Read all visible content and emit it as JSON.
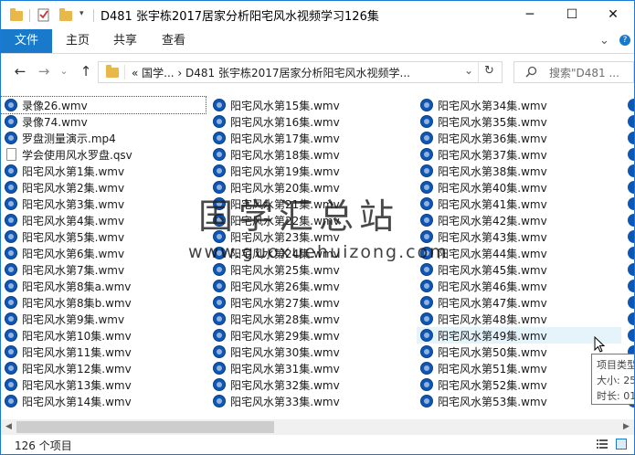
{
  "window": {
    "title": "D481 张宇栋2017居家分析阳宅风水视频学习126集",
    "minimize": "─",
    "maximize": "☐",
    "close": "✕"
  },
  "ribbon": {
    "file": "文件",
    "tabs": [
      "主页",
      "共享",
      "查看"
    ],
    "expand": "⌄",
    "help": "?"
  },
  "address": {
    "path": "« 国学...  ›  D481 张宇栋2017居家分析阳宅风水视频学...",
    "dropdown": "⌄",
    "refresh": "↻"
  },
  "search": {
    "placeholder": "搜索\"D481 ..."
  },
  "nav": {
    "back": "←",
    "forward": "→",
    "recent": "⌄",
    "up": "↑"
  },
  "files": {
    "col1": [
      {
        "name": "录像26.wmv",
        "icon": "media"
      },
      {
        "name": "录像74.wmv",
        "icon": "media"
      },
      {
        "name": "罗盘测量演示.mp4",
        "icon": "media"
      },
      {
        "name": "学会使用风水罗盘.qsv",
        "icon": "doc"
      },
      {
        "name": "阳宅风水第1集.wmv",
        "icon": "media"
      },
      {
        "name": "阳宅风水第2集.wmv",
        "icon": "media"
      },
      {
        "name": "阳宅风水第3集.wmv",
        "icon": "media"
      },
      {
        "name": "阳宅风水第4集.wmv",
        "icon": "media"
      },
      {
        "name": "阳宅风水第5集.wmv",
        "icon": "media"
      },
      {
        "name": "阳宅风水第6集.wmv",
        "icon": "media"
      },
      {
        "name": "阳宅风水第7集.wmv",
        "icon": "media"
      },
      {
        "name": "阳宅风水第8集a.wmv",
        "icon": "media"
      },
      {
        "name": "阳宅风水第8集b.wmv",
        "icon": "media"
      },
      {
        "name": "阳宅风水第9集.wmv",
        "icon": "media"
      },
      {
        "name": "阳宅风水第10集.wmv",
        "icon": "media"
      },
      {
        "name": "阳宅风水第11集.wmv",
        "icon": "media"
      },
      {
        "name": "阳宅风水第12集.wmv",
        "icon": "media"
      },
      {
        "name": "阳宅风水第13集.wmv",
        "icon": "media"
      },
      {
        "name": "阳宅风水第14集.wmv",
        "icon": "media"
      }
    ],
    "col2": [
      {
        "name": "阳宅风水第15集.wmv"
      },
      {
        "name": "阳宅风水第16集.wmv"
      },
      {
        "name": "阳宅风水第17集.wmv"
      },
      {
        "name": "阳宅风水第18集.wmv"
      },
      {
        "name": "阳宅风水第19集.wmv"
      },
      {
        "name": "阳宅风水第20集.wmv"
      },
      {
        "name": "阳宅风水第21集.wmv"
      },
      {
        "name": "阳宅风水第22集.wmv"
      },
      {
        "name": "阳宅风水第23集.wmv"
      },
      {
        "name": "阳宅风水第24集.wmv"
      },
      {
        "name": "阳宅风水第25集.wmv"
      },
      {
        "name": "阳宅风水第26集.wmv"
      },
      {
        "name": "阳宅风水第27集.wmv"
      },
      {
        "name": "阳宅风水第28集.wmv"
      },
      {
        "name": "阳宅风水第29集.wmv"
      },
      {
        "name": "阳宅风水第30集.wmv"
      },
      {
        "name": "阳宅风水第31集.wmv"
      },
      {
        "name": "阳宅风水第32集.wmv"
      },
      {
        "name": "阳宅风水第33集.wmv"
      }
    ],
    "col3": [
      {
        "name": "阳宅风水第34集.wmv"
      },
      {
        "name": "阳宅风水第35集.wmv"
      },
      {
        "name": "阳宅风水第36集.wmv"
      },
      {
        "name": "阳宅风水第37集.wmv"
      },
      {
        "name": "阳宅风水第38集.wmv"
      },
      {
        "name": "阳宅风水第40集.wmv"
      },
      {
        "name": "阳宅风水第41集.wmv"
      },
      {
        "name": "阳宅风水第42集.wmv"
      },
      {
        "name": "阳宅风水第43集.wmv"
      },
      {
        "name": "阳宅风水第44集.wmv"
      },
      {
        "name": "阳宅风水第45集.wmv"
      },
      {
        "name": "阳宅风水第46集.wmv"
      },
      {
        "name": "阳宅风水第47集.wmv"
      },
      {
        "name": "阳宅风水第48集.wmv"
      },
      {
        "name": "阳宅风水第49集.wmv"
      },
      {
        "name": "阳宅风水第50集.wmv"
      },
      {
        "name": "阳宅风水第51集.wmv"
      },
      {
        "name": "阳宅风水第52集.wmv"
      },
      {
        "name": "阳宅风水第53集.wmv"
      }
    ]
  },
  "tooltip": {
    "line1": "项目类型",
    "line2": "大小: 25",
    "line3": "时长: 01"
  },
  "watermark": {
    "main": "国学汇总站",
    "url": "www.guoxuehuizong.com"
  },
  "status": {
    "count": "126 个项目"
  },
  "colors": {
    "accent": "#1979ca",
    "media_icon": "#0e57b4"
  }
}
